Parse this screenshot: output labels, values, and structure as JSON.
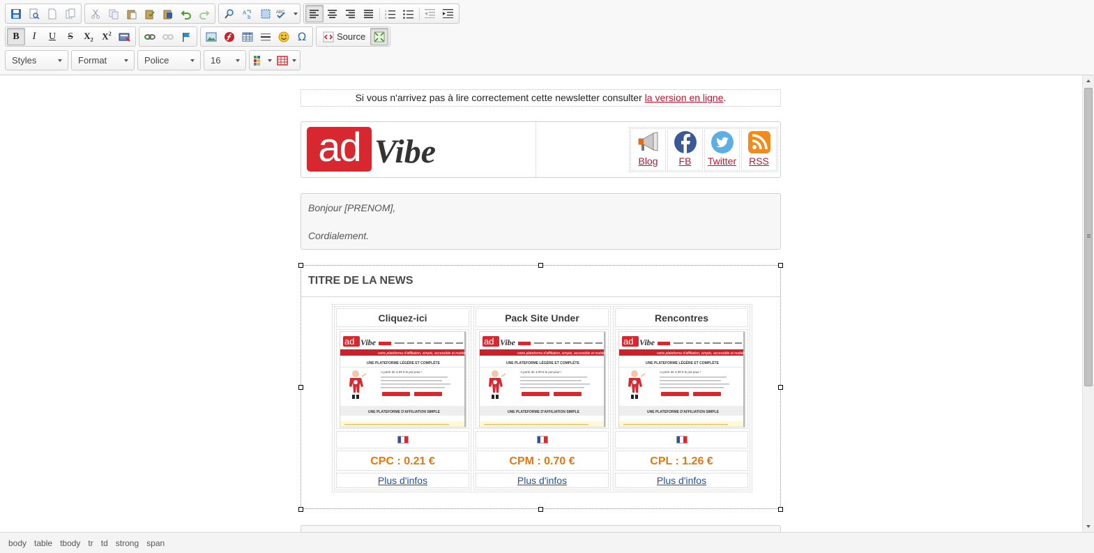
{
  "toolbar": {
    "source_label": "Source",
    "combos": {
      "styles": "Styles",
      "format": "Format",
      "font": "Police",
      "size": "16"
    }
  },
  "editor": {
    "notice_text": "Si vous n'arrivez pas à lire correctement cette newsletter consulter ",
    "notice_link": "la version en ligne",
    "notice_end": ".",
    "logo": {
      "ad": "ad",
      "vibe": "Vibe"
    },
    "social": [
      {
        "label": "Blog",
        "icon": "megaphone-icon"
      },
      {
        "label": "FB",
        "icon": "facebook-icon"
      },
      {
        "label": "Twitter",
        "icon": "twitter-icon"
      },
      {
        "label": "RSS",
        "icon": "rss-icon"
      }
    ],
    "greeting": "Bonjour [PRENOM],",
    "closing": "Cordialement.",
    "news_title": "TITRE DE LA NEWS",
    "offers": [
      {
        "name": "Cliquez-ici",
        "price": "CPC : 0.21 €",
        "more": "Plus d'infos"
      },
      {
        "name": "Pack Site Under",
        "price": "CPM : 0.70 €",
        "more": "Plus d'infos"
      },
      {
        "name": "Rencontres",
        "price": "CPL : 1.26 €",
        "more": "Plus d'infos"
      }
    ],
    "screenshot": {
      "tagline": "votre plateforme d'affiliation, simple, accessible et mobile",
      "heading": "UNE PLATEFORME LÉGÈRE ET COMPLÈTE",
      "price_line": "A partir de 4,99 € le pot pour !",
      "footer_heading": "UNE PLATEFORME D'AFFILIATION SIMPLE"
    }
  },
  "statusbar": {
    "path": [
      "body",
      "table",
      "tbody",
      "tr",
      "td",
      "strong",
      "span"
    ]
  },
  "colors": {
    "brand_red": "#d7282f",
    "link_red": "#c8102e",
    "price_orange": "#e8760a",
    "link_blue": "#1f4f99"
  }
}
